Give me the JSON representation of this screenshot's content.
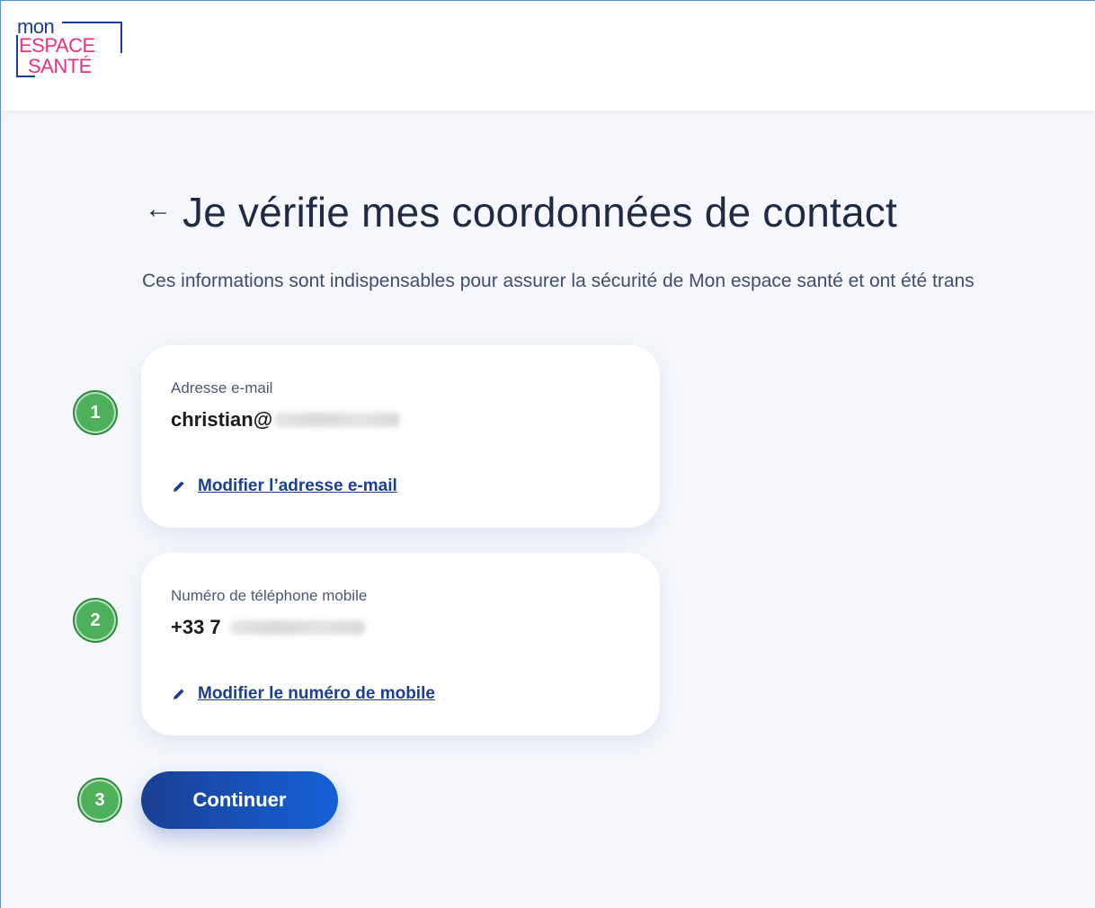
{
  "header": {
    "logo": {
      "line1": "mon",
      "line2": "ESPACE",
      "line3": "SANTÉ",
      "colors": {
        "mon": "#1d3f8f",
        "espace_sante": "#e8347e"
      }
    }
  },
  "page": {
    "back_icon": "arrow-left-icon",
    "back_glyph": "←",
    "title": "Je vérifie mes coordonnées de contact",
    "subtitle": "Ces informations sont indispensables pour assurer la sécurité de Mon espace santé et ont été trans"
  },
  "cards": {
    "email": {
      "label": "Adresse e-mail",
      "value_visible": "christian@",
      "link_icon": "pencil-icon",
      "link_label": "Modifier l’adresse e-mail"
    },
    "phone": {
      "label": "Numéro de téléphone mobile",
      "value_visible": "+33 7",
      "link_icon": "pencil-icon",
      "link_label": "Modifier le numéro de mobile"
    }
  },
  "steps": {
    "step1": "1",
    "step2": "2",
    "step3": "3",
    "color": "#4fb05c"
  },
  "actions": {
    "continue_label": "Continuer",
    "button_colors": [
      "#1a3f94",
      "#1561d8"
    ]
  },
  "colors": {
    "background": "#f5f7fc",
    "link": "#1d3f8f",
    "title": "#1f2a44"
  }
}
